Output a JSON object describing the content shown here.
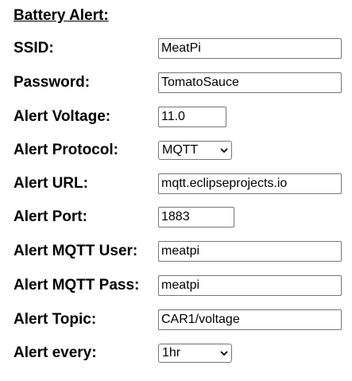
{
  "section_title": "Battery Alert:",
  "fields": {
    "ssid": {
      "label": "SSID:",
      "value": "MeatPi"
    },
    "password": {
      "label": "Password:",
      "value": "TomatoSauce"
    },
    "alert_voltage": {
      "label": "Alert Voltage:",
      "value": "11.0"
    },
    "alert_protocol": {
      "label": "Alert Protocol:",
      "selected": "MQTT",
      "icon": "chevron-down-icon"
    },
    "alert_url": {
      "label": "Alert URL:",
      "value": "mqtt.eclipseprojects.io"
    },
    "alert_port": {
      "label": "Alert Port:",
      "value": "1883"
    },
    "alert_mqtt_user": {
      "label": "Alert MQTT User:",
      "value": "meatpi"
    },
    "alert_mqtt_pass": {
      "label": "Alert MQTT Pass:",
      "value": "meatpi"
    },
    "alert_topic": {
      "label": "Alert Topic:",
      "value": "CAR1/voltage"
    },
    "alert_every": {
      "label": "Alert every:",
      "selected": "1hr",
      "icon": "chevron-down-icon"
    }
  }
}
